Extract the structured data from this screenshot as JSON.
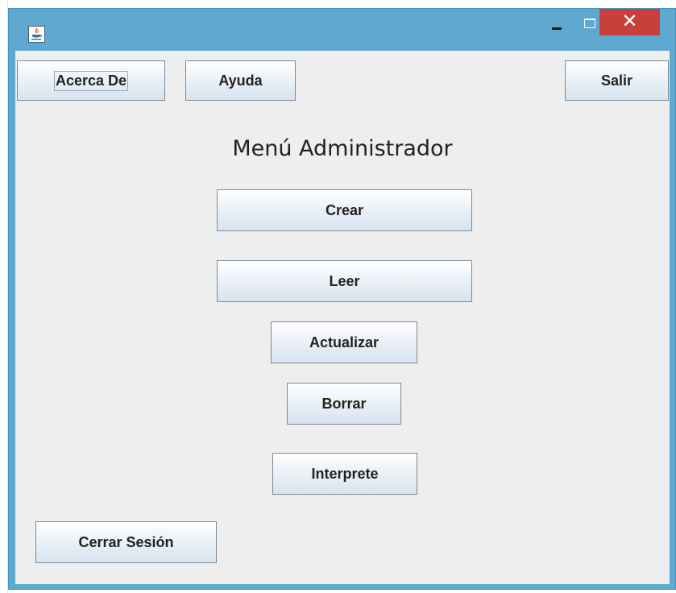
{
  "window": {
    "close_glyph": "✕"
  },
  "toolbar": {
    "about_label": "Acerca De",
    "help_label": "Ayuda",
    "exit_label": "Salir"
  },
  "menu": {
    "title": "Menú Administrador",
    "create_label": "Crear",
    "read_label": "Leer",
    "update_label": "Actualizar",
    "delete_label": "Borrar",
    "interpreter_label": "Interprete"
  },
  "footer": {
    "logout_label": "Cerrar Sesión"
  },
  "icons": [
    "java-app-icon",
    "minimize-icon",
    "maximize-icon",
    "close-icon"
  ],
  "colors": {
    "titlebar": "#5fa9d0",
    "close_button": "#c9403a",
    "panel": "#eeeeee"
  }
}
